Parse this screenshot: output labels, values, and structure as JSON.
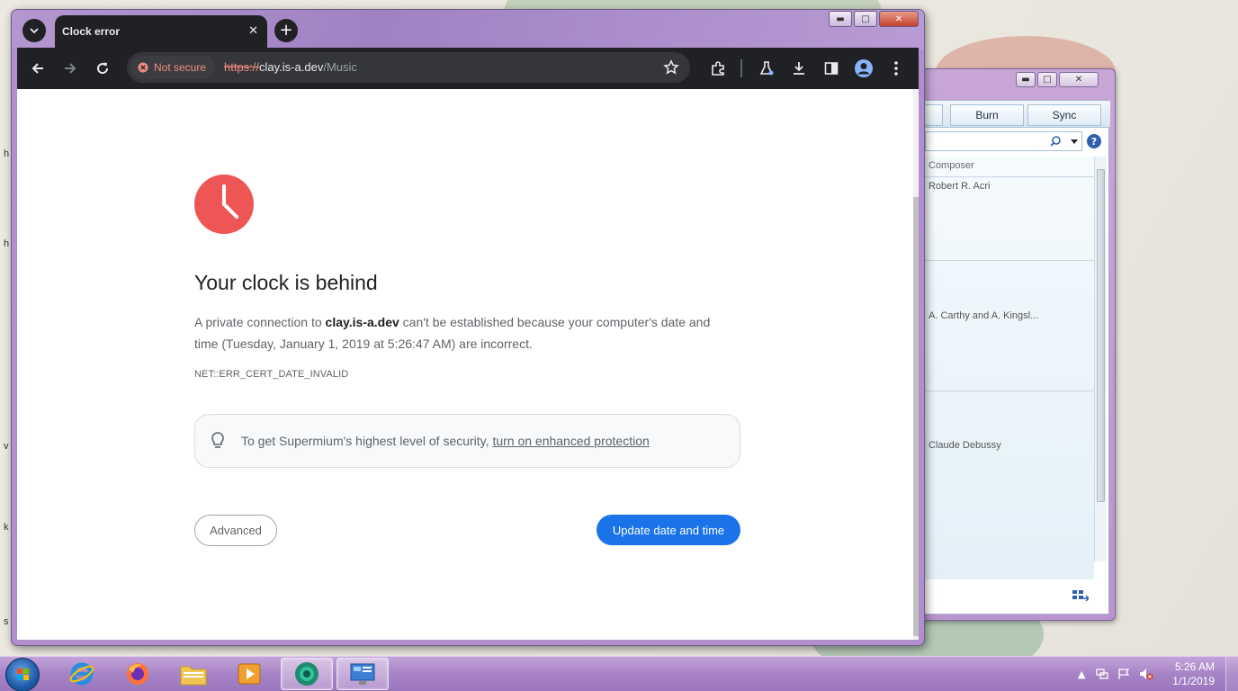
{
  "browser": {
    "tab_title": "Clock error",
    "url_scheme": "https://",
    "url_host": "clay.is-a.dev",
    "url_path": "/Music",
    "security_chip": "Not secure"
  },
  "error_page": {
    "title": "Your clock is behind",
    "body_prefix": "A private connection to ",
    "body_host": "clay.is-a.dev",
    "body_suffix": " can't be established because your computer's date and time (Tuesday, January 1, 2019 at 5:26:47 AM) are incorrect.",
    "error_code": "NET::ERR_CERT_DATE_INVALID",
    "tip_text": "To get Supermium's highest level of security, ",
    "tip_link": "turn on enhanced protection",
    "advanced_button": "Advanced",
    "update_button": "Update date and time"
  },
  "media_player": {
    "tabs": [
      "Burn",
      "Sync"
    ],
    "column_header": "Composer",
    "rows": [
      "Robert R. Acri",
      "A. Carthy and A. Kingsl...",
      "Claude Debussy"
    ]
  },
  "taskbar": {
    "time": "5:26 AM",
    "date": "1/1/2019"
  },
  "colors": {
    "accent_blue": "#1a73e8",
    "clock_red": "#ee5555",
    "not_secure_red": "#f28b82"
  }
}
